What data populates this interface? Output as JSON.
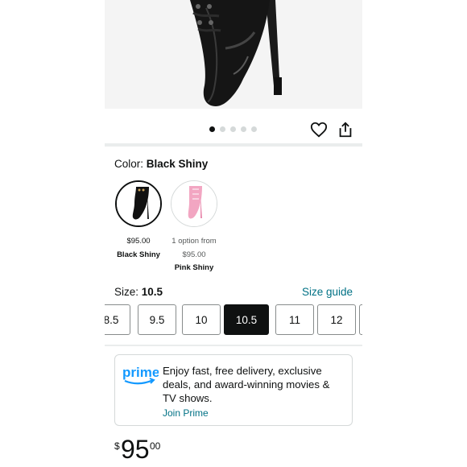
{
  "gallery": {
    "dot_count": 5,
    "active_index": 0,
    "icons": {
      "favorite": "heart-icon",
      "share": "share-icon"
    }
  },
  "color": {
    "label": "Color: ",
    "selected": "Black Shiny",
    "options": [
      {
        "price": "$95.00",
        "name": "Black Shiny",
        "note": ""
      },
      {
        "note": "1 option from",
        "price": "$95.00",
        "name": "Pink Shiny"
      }
    ]
  },
  "size": {
    "label": "Size: ",
    "selected": "10.5",
    "guide_label": "Size guide",
    "options": [
      "8.5",
      "9.5",
      "10",
      "10.5",
      "11",
      "12"
    ]
  },
  "prime": {
    "logo_text": "prime",
    "message": "Enjoy fast, free delivery, exclusive deals, and award-winning movies & TV shows.",
    "link": "Join Prime",
    "brand_color": "#1399ff"
  },
  "price": {
    "symbol": "$",
    "whole": "95",
    "fraction": "00"
  },
  "colors": {
    "link": "#007185",
    "selected_bg": "#0f1111"
  }
}
